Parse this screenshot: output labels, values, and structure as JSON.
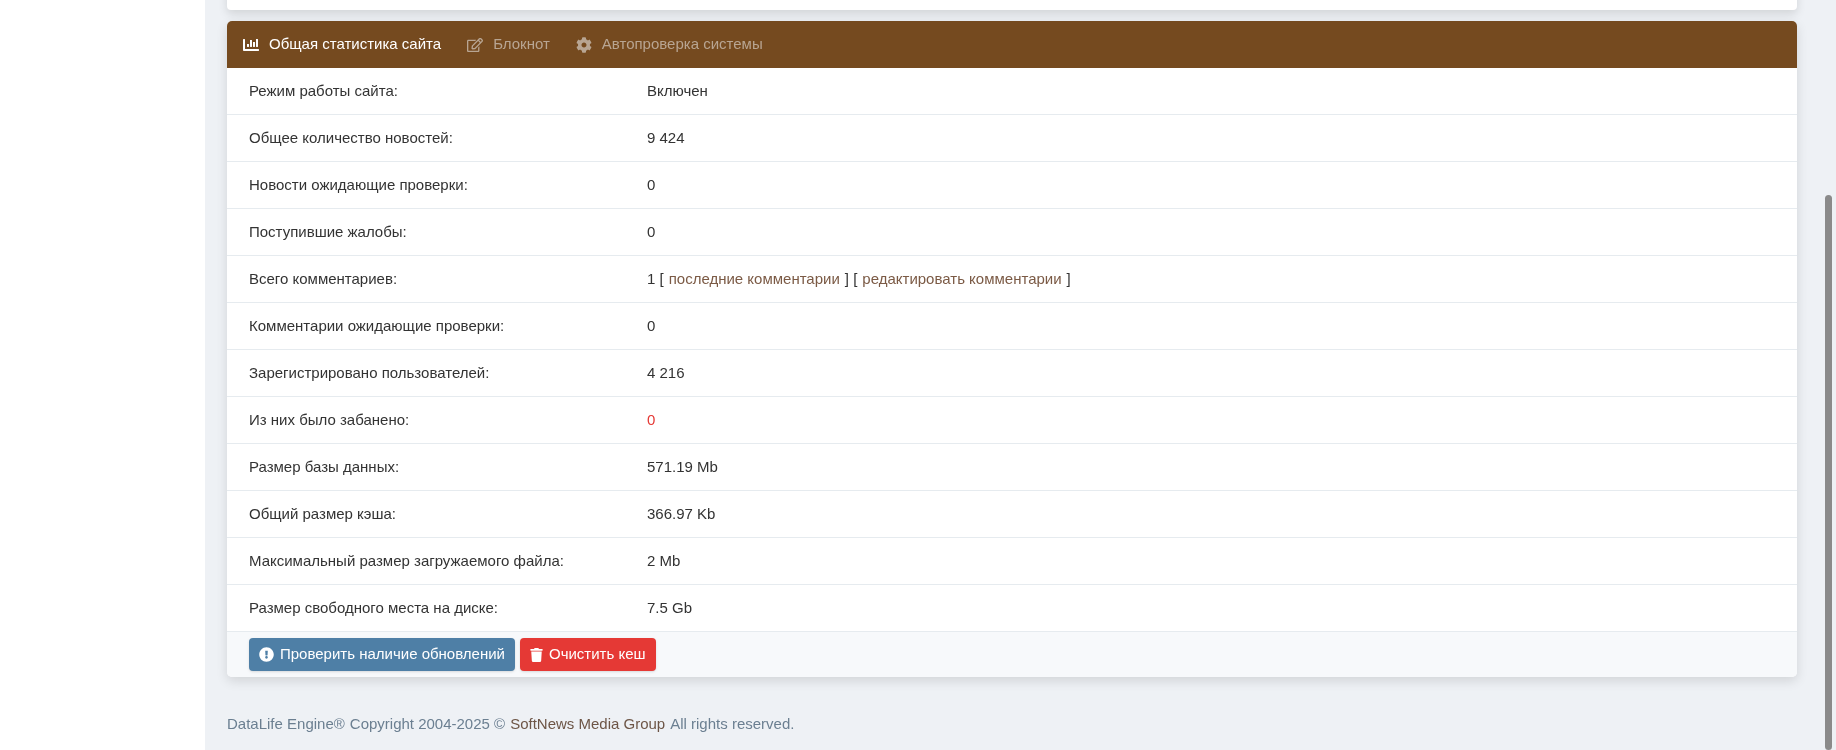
{
  "tabs": [
    {
      "kind": "chart",
      "label": "Общая статистика сайта",
      "selected": true
    },
    {
      "kind": "edit",
      "label": "Блокнот",
      "selected": false
    },
    {
      "kind": "gear",
      "label": "Автопроверка системы",
      "selected": false
    }
  ],
  "rows": [
    {
      "label": "Режим работы сайта:",
      "parts": [
        {
          "kind": "text",
          "text": "Включен"
        }
      ]
    },
    {
      "label": "Общее количество новостей:",
      "parts": [
        {
          "kind": "text",
          "text": "9 424"
        }
      ]
    },
    {
      "label": "Новости ожидающие проверки:",
      "parts": [
        {
          "kind": "text",
          "text": "0"
        }
      ]
    },
    {
      "label": "Поступившие жалобы:",
      "parts": [
        {
          "kind": "text",
          "text": "0"
        }
      ]
    },
    {
      "label": "Всего комментариев:",
      "parts": [
        {
          "kind": "text",
          "text": "1 ["
        },
        {
          "kind": "link",
          "text": "последние комментарии"
        },
        {
          "kind": "text",
          "text": "] ["
        },
        {
          "kind": "link",
          "text": "редактировать комментарии"
        },
        {
          "kind": "text",
          "text": "]"
        }
      ]
    },
    {
      "label": "Комментарии ожидающие проверки:",
      "parts": [
        {
          "kind": "text",
          "text": "0"
        }
      ]
    },
    {
      "label": "Зарегистрировано пользователей:",
      "parts": [
        {
          "kind": "text",
          "text": "4 216"
        }
      ]
    },
    {
      "label": "Из них было забанено:",
      "parts": [
        {
          "kind": "danger",
          "text": "0"
        }
      ]
    },
    {
      "label": "Размер базы данных:",
      "parts": [
        {
          "kind": "text",
          "text": "571.19 Mb"
        }
      ]
    },
    {
      "label": "Общий размер кэша:",
      "parts": [
        {
          "kind": "text",
          "text": "366.97 Kb"
        }
      ]
    },
    {
      "label": "Максимальный размер загружаемого файла:",
      "parts": [
        {
          "kind": "text",
          "text": "2 Mb"
        }
      ]
    },
    {
      "label": "Размер свободного места на диске:",
      "parts": [
        {
          "kind": "text",
          "text": "7.5 Gb"
        }
      ]
    }
  ],
  "buttons": [
    {
      "kind": "update",
      "label": "Проверить наличие обновлений"
    },
    {
      "kind": "clear",
      "label": "Очистить кеш"
    }
  ],
  "footer": [
    {
      "kind": "link",
      "text": "DataLife Engine®"
    },
    {
      "kind": "text",
      "text": "Copyright 2004-2025 ©"
    },
    {
      "kind": "brand",
      "text": "SoftNews Media Group"
    },
    {
      "kind": "text",
      "text": "All rights reserved."
    }
  ]
}
